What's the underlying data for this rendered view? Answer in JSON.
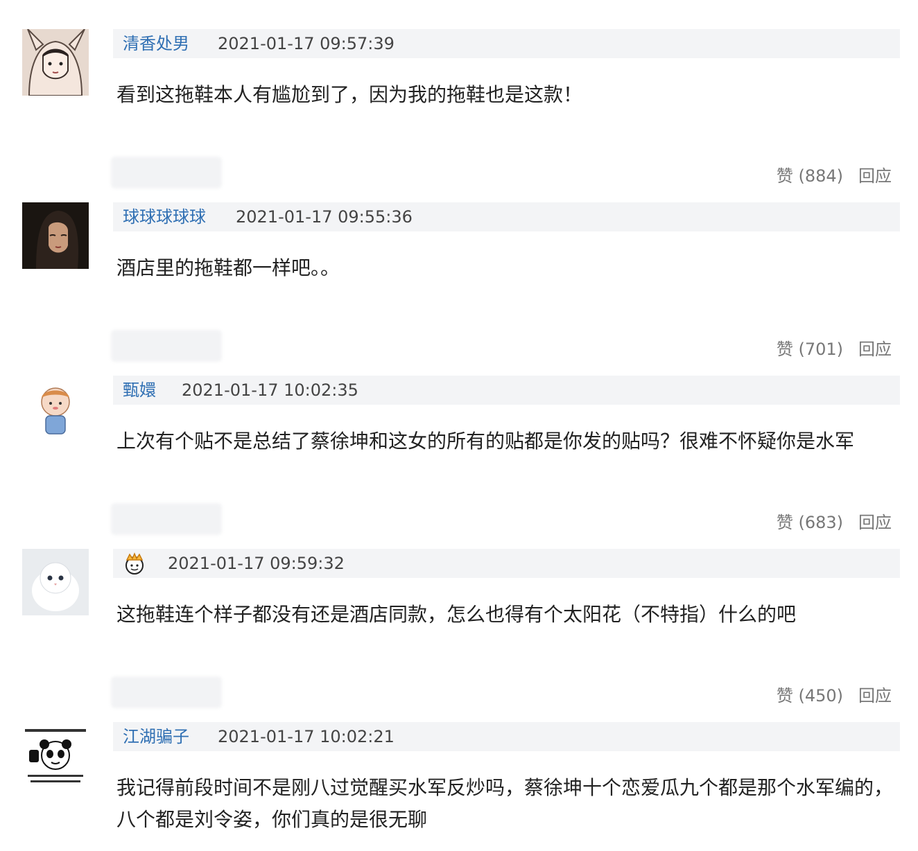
{
  "comments": [
    {
      "username": "清香处男",
      "time": "2021-01-17 09:57:39",
      "content": "看到这拖鞋本人有尴尬到了，因为我的拖鞋也是这款！",
      "like": "赞 (884)",
      "reply": "回应"
    },
    {
      "username": "球球球球球",
      "time": "2021-01-17 09:55:36",
      "content": "酒店里的拖鞋都一样吧。。",
      "like": "赞 (701)",
      "reply": "回应"
    },
    {
      "username": "甄嬛",
      "time": "2021-01-17 10:02:35",
      "content": "上次有个贴不是总结了蔡徐坤和这女的所有的贴都是你发的贴吗？很难不怀疑你是水军",
      "like": "赞 (683)",
      "reply": "回应"
    },
    {
      "username": "",
      "time": "2021-01-17 09:59:32",
      "content": "这拖鞋连个样子都没有还是酒店同款，怎么也得有个太阳花（不特指）什么的吧",
      "like": "赞 (450)",
      "reply": "回应"
    },
    {
      "username": "江湖骗子",
      "time": "2021-01-17 10:02:21",
      "content_line1": "我记得前段时间不是刚八过觉醒买水军反炒吗，蔡徐坤十个恋爱瓜九个都是那个水军编的，",
      "content_line2": "八个都是刘令姿，你们真的是很无聊"
    }
  ],
  "icons": {
    "avatar1": "cartoon-bunny-hood-avatar",
    "avatar2": "woman-portrait-avatar",
    "avatar3": "cartoon-boy-avatar",
    "avatar4": "white-kitten-avatar",
    "avatar5": "panda-meme-avatar",
    "user4_badge": "crown-face-icon"
  },
  "colors": {
    "username": "#2f6fb3",
    "header_bg": "#f3f4f6",
    "meta_text": "#777777"
  }
}
